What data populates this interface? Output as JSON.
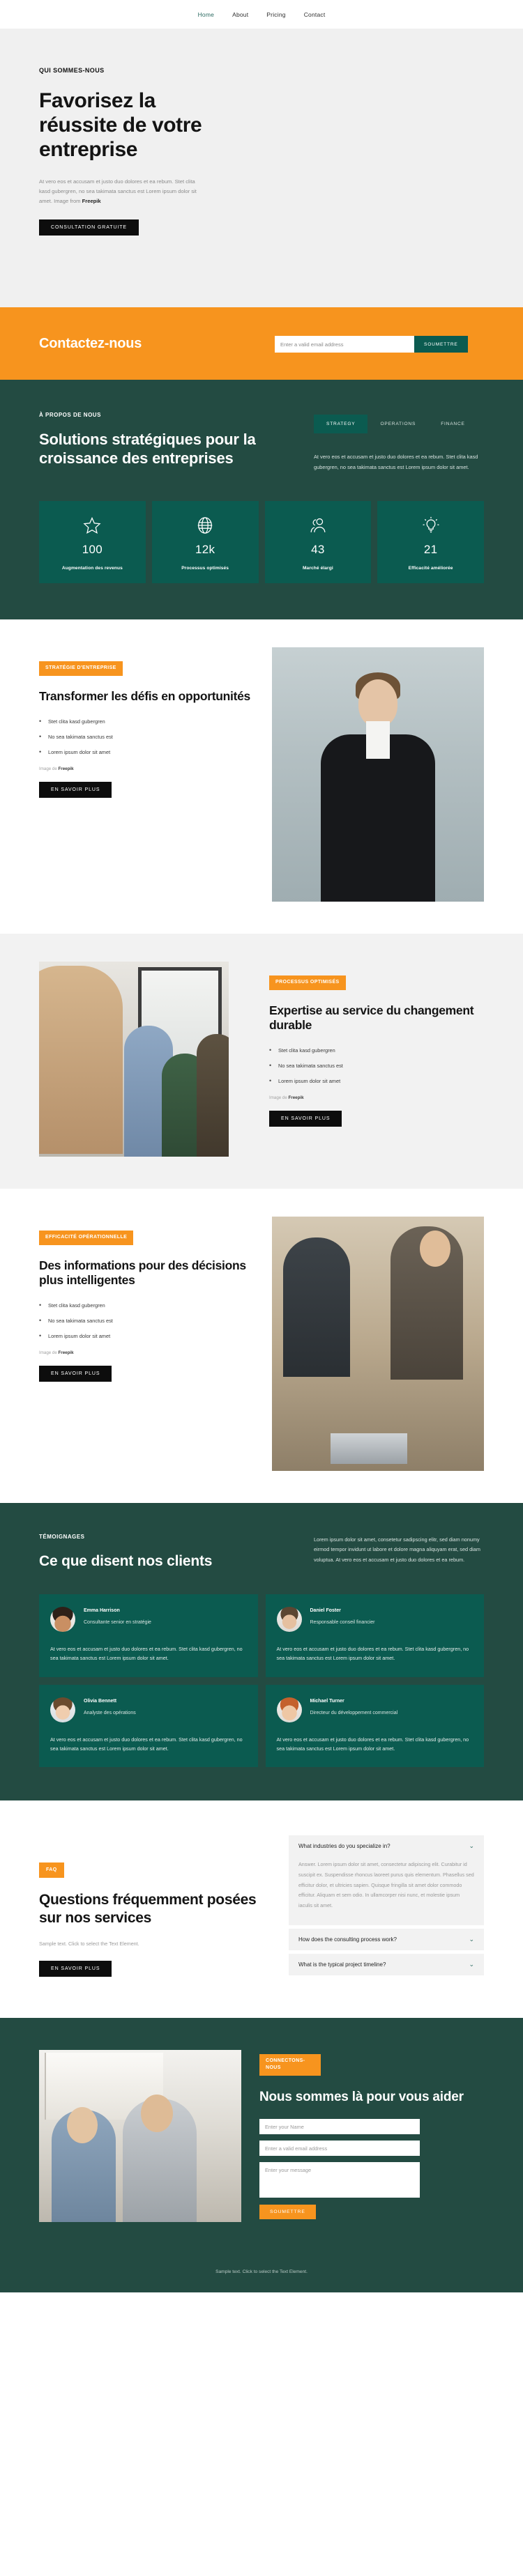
{
  "nav": {
    "items": [
      {
        "label": "Home",
        "active": true
      },
      {
        "label": "About",
        "active": false
      },
      {
        "label": "Pricing",
        "active": false
      },
      {
        "label": "Contact",
        "active": false
      }
    ]
  },
  "hero": {
    "eyebrow": "QUI SOMMES-NOUS",
    "title": "Favorisez la réussite de votre entreprise",
    "paragraph": "At vero eos et accusam et justo duo dolores et ea rebum. Stet clita kasd gubergren, no sea takimata sanctus est Lorem ipsum dolor sit amet. Image from ",
    "paragraph_bold": "Freepik",
    "cta": "CONSULTATION GRATUITE"
  },
  "newsletter": {
    "title": "Contactez-nous",
    "email_placeholder": "Enter a valid email address",
    "submit": "SOUMETTRE"
  },
  "about": {
    "eyebrow": "À PROPOS DE NOUS",
    "title": "Solutions stratégiques pour la croissance des entreprises",
    "tabs": [
      {
        "label": "STRATEGY",
        "active": true
      },
      {
        "label": "OPERATIONS",
        "active": false
      },
      {
        "label": "FINANCE",
        "active": false
      }
    ],
    "paragraph": "At vero eos et accusam et justo duo dolores et ea rebum. Stet clita kasd gubergren, no sea takimata sanctus est Lorem ipsum dolor sit amet.",
    "stats": [
      {
        "icon": "star-icon",
        "value": "100",
        "label": "Augmentation des revenus"
      },
      {
        "icon": "globe-icon",
        "value": "12k",
        "label": "Processus optimisés"
      },
      {
        "icon": "users-icon",
        "value": "43",
        "label": "Marché élargi"
      },
      {
        "icon": "lightbulb-icon",
        "value": "21",
        "label": "Efficacité améliorée"
      }
    ]
  },
  "features": [
    {
      "badge": "STRATÉGIE D'ENTREPRISE",
      "title": "Transformer les défis en opportunités",
      "bullets": [
        "Stet clita kasd gubergren",
        "No sea takimata sanctus est",
        "Lorem ipsum dolor sit amet"
      ],
      "credit_prefix": "Image de ",
      "credit_bold": "Freepik",
      "cta": "EN SAVOIR PLUS"
    },
    {
      "badge": "PROCESSUS OPTIMISÉS",
      "title": "Expertise au service du changement durable",
      "bullets": [
        "Stet clita kasd gubergren",
        "No sea takimata sanctus est",
        "Lorem ipsum dolor sit amet"
      ],
      "credit_prefix": "Image de ",
      "credit_bold": "Freepik",
      "cta": "EN SAVOIR PLUS"
    },
    {
      "badge": "EFFICACITÉ OPÉRATIONNELLE",
      "title": "Des informations pour des décisions plus intelligentes",
      "bullets": [
        "Stet clita kasd gubergren",
        "No sea takimata sanctus est",
        "Lorem ipsum dolor sit amet"
      ],
      "credit_prefix": "Image de ",
      "credit_bold": "Freepik",
      "cta": "EN SAVOIR PLUS"
    }
  ],
  "testimonials": {
    "eyebrow": "TÉMOIGNAGES",
    "title": "Ce que disent nos clients",
    "intro": "Lorem ipsum dolor sit amet, consetetur sadipscing elitr, sed diam nonumy eirmod tempor invidunt ut labore et dolore magna aliquyam erat, sed diam voluptua. At vero eos et accusam et justo duo dolores et ea rebum.",
    "cards": [
      {
        "name": "Emma Harrison",
        "role": "Consultante senior en stratégie",
        "quote": "At vero eos et accusam et justo duo dolores et ea rebum. Stet clita kasd gubergren, no sea takimata sanctus est Lorem ipsum dolor sit amet."
      },
      {
        "name": "Daniel Foster",
        "role": "Responsable conseil financier",
        "quote": "At vero eos et accusam et justo duo dolores et ea rebum. Stet clita kasd gubergren, no sea takimata sanctus est Lorem ipsum dolor sit amet."
      },
      {
        "name": "Olivia Bennett",
        "role": "Analyste des opérations",
        "quote": "At vero eos et accusam et justo duo dolores et ea rebum. Stet clita kasd gubergren, no sea takimata sanctus est Lorem ipsum dolor sit amet."
      },
      {
        "name": "Michael Turner",
        "role": "Directeur du développement commercial",
        "quote": "At vero eos et accusam et justo duo dolores et ea rebum. Stet clita kasd gubergren, no sea takimata sanctus est Lorem ipsum dolor sit amet."
      }
    ]
  },
  "faq": {
    "badge": "FAQ",
    "title": "Questions fréquemment posées sur nos services",
    "note": "Sample text. Click to select the Text Element.",
    "cta": "EN SAVOIR PLUS",
    "items": [
      {
        "question": "What industries do you specialize in?",
        "open": true,
        "answer": "Answer. Lorem ipsum dolor sit amet, consectetur adipiscing elit. Curabitur id suscipit ex. Suspendisse rhoncus laoreet purus quis elementum. Phasellus sed efficitur dolor, et ultricies sapien. Quisque fringilla sit amet dolor commodo efficitur. Aliquam et sem odio. In ullamcorper nisi nunc, et molestie ipsum iaculis sit amet."
      },
      {
        "question": "How does the consulting process work?",
        "open": false,
        "answer": ""
      },
      {
        "question": "What is the typical project timeline?",
        "open": false,
        "answer": ""
      }
    ]
  },
  "contact": {
    "badge": "CONNECTONS-NOUS",
    "title": "Nous sommes là pour vous aider",
    "name_placeholder": "Enter your Name",
    "email_placeholder": "Enter a valid email address",
    "message_placeholder": "Enter your message",
    "submit": "SOUMETTRE"
  },
  "footer": {
    "text": "Sample text. Click to select the Text Element."
  },
  "colors": {
    "orange": "#f7941e",
    "dark_teal": "#234b42",
    "teal": "#0b5b50",
    "black": "#0d0d0d"
  }
}
